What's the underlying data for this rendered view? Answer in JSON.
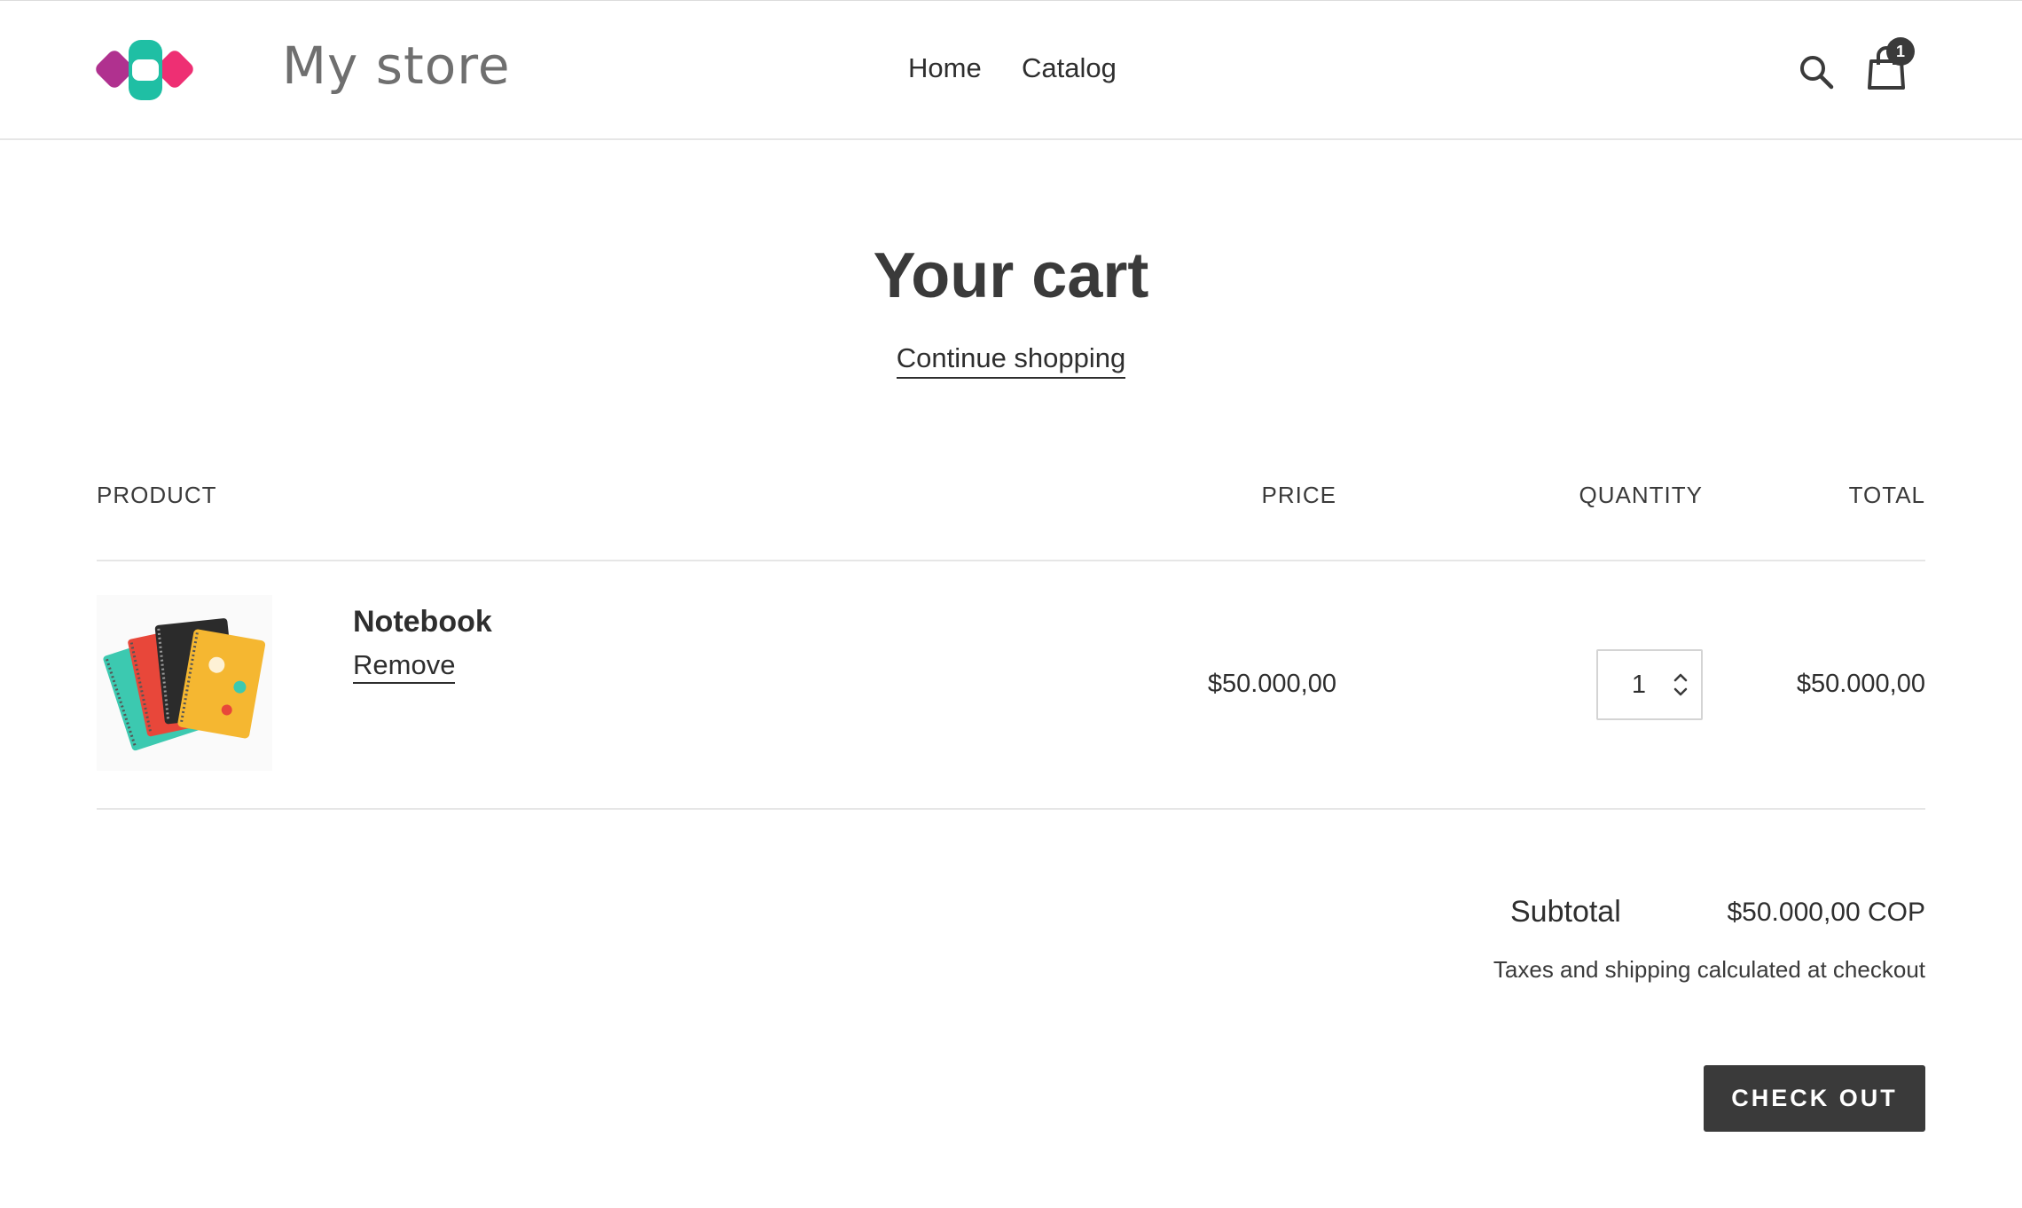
{
  "header": {
    "store_name": "My store",
    "nav": [
      {
        "label": "Home"
      },
      {
        "label": "Catalog"
      }
    ],
    "cart_count": "1"
  },
  "page": {
    "title": "Your cart",
    "continue_label": "Continue shopping"
  },
  "table": {
    "headers": {
      "product": "PRODUCT",
      "price": "PRICE",
      "quantity": "QUANTITY",
      "total": "TOTAL"
    },
    "items": [
      {
        "name": "Notebook",
        "remove_label": "Remove",
        "price": "$50.000,00",
        "quantity": "1",
        "total": "$50.000,00"
      }
    ]
  },
  "summary": {
    "subtotal_label": "Subtotal",
    "subtotal_value": "$50.000,00 COP",
    "tax_note": "Taxes and shipping calculated at checkout",
    "checkout_label": "CHECK OUT"
  },
  "colors": {
    "text": "#3a3a3a",
    "button": "#3a3a3a",
    "divider": "#e6e6e6",
    "logo_magenta": "#b0318f",
    "logo_pink": "#ee2f73",
    "logo_teal": "#1fbfa4"
  }
}
